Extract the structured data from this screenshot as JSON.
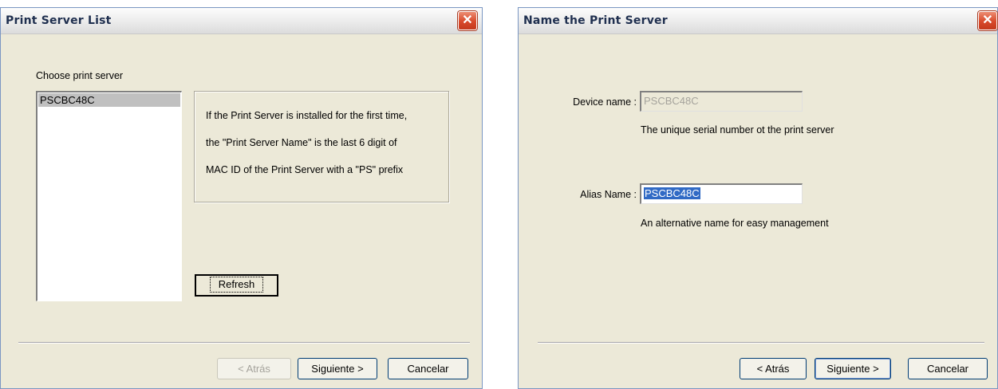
{
  "left_dialog": {
    "title": "Print Server List",
    "close_glyph": "✕",
    "list_label": "Choose print server",
    "list_items": [
      "PSCBC48C"
    ],
    "info_lines": [
      "If the Print Server is installed for the first time,",
      "the \"Print Server Name\" is the last 6 digit of",
      "MAC ID of the Print Server with a \"PS\" prefix"
    ],
    "refresh_label": "Refresh",
    "back_label": "< Atrás",
    "next_label": "Siguiente >",
    "cancel_label": "Cancelar"
  },
  "right_dialog": {
    "title": "Name the Print Server",
    "close_glyph": "✕",
    "device_name_label": "Device name :",
    "device_name_value": "PSCBC48C",
    "device_name_hint": "The unique serial number ot the print server",
    "alias_name_label": "Alias Name :",
    "alias_name_value": "PSCBC48C",
    "alias_name_hint": "An alternative name for easy management",
    "back_label": "< Atrás",
    "next_label": "Siguiente >",
    "cancel_label": "Cancelar"
  }
}
